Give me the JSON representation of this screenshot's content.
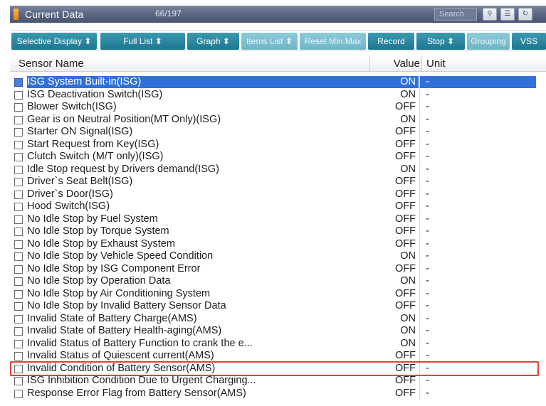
{
  "window": {
    "title": "Current Data",
    "count": "66/197",
    "search_placeholder": "Search"
  },
  "toolbar": {
    "buttons": [
      {
        "label": "Selective Display ⬍",
        "enabled": true
      },
      {
        "label": "Full List   ⬍",
        "enabled": true
      },
      {
        "label": "Graph  ⬍",
        "enabled": true
      },
      {
        "label": "Items List ⬍",
        "enabled": false
      },
      {
        "label": "Reset Min.Max",
        "enabled": false
      },
      {
        "label": "Record",
        "enabled": true
      },
      {
        "label": "Stop  ⬍",
        "enabled": true
      },
      {
        "label": "Grouping",
        "enabled": false
      },
      {
        "label": "VSS",
        "enabled": true
      }
    ]
  },
  "table": {
    "headers": {
      "name": "Sensor Name",
      "value": "Value",
      "unit": "Unit"
    },
    "rows": [
      {
        "name": "ISG System Built-in(ISG)",
        "value": "ON",
        "unit": "-"
      },
      {
        "name": "ISG Deactivation Switch(ISG)",
        "value": "ON",
        "unit": "-"
      },
      {
        "name": "Blower Switch(ISG)",
        "value": "OFF",
        "unit": "-"
      },
      {
        "name": "Gear is on Neutral Position(MT Only)(ISG)",
        "value": "ON",
        "unit": "-"
      },
      {
        "name": "Starter ON Signal(ISG)",
        "value": "OFF",
        "unit": "-"
      },
      {
        "name": "Start Request from Key(ISG)",
        "value": "OFF",
        "unit": "-"
      },
      {
        "name": "Clutch Switch (M/T only)(ISG)",
        "value": "OFF",
        "unit": "-"
      },
      {
        "name": "Idle Stop request by Drivers demand(ISG)",
        "value": "ON",
        "unit": "-"
      },
      {
        "name": "Driver`s Seat Belt(ISG)",
        "value": "OFF",
        "unit": "-"
      },
      {
        "name": "Driver`s Door(ISG)",
        "value": "OFF",
        "unit": "-"
      },
      {
        "name": "Hood Switch(ISG)",
        "value": "OFF",
        "unit": "-"
      },
      {
        "name": "No Idle Stop by Fuel System",
        "value": "OFF",
        "unit": "-"
      },
      {
        "name": "No Idle Stop by Torque System",
        "value": "OFF",
        "unit": "-"
      },
      {
        "name": "No Idle Stop by Exhaust System",
        "value": "OFF",
        "unit": "-"
      },
      {
        "name": "No Idle Stop by Vehicle Speed Condition",
        "value": "ON",
        "unit": "-"
      },
      {
        "name": "No Idle Stop by ISG Component Error",
        "value": "OFF",
        "unit": "-"
      },
      {
        "name": "No Idle Stop by Operation Data",
        "value": "ON",
        "unit": "-"
      },
      {
        "name": "No Idle Stop by Air Conditioning System",
        "value": "OFF",
        "unit": "-"
      },
      {
        "name": "No Idle Stop by Invalid Battery Sensor Data",
        "value": "OFF",
        "unit": "-"
      },
      {
        "name": "Invalid State of Battery Charge(AMS)",
        "value": "ON",
        "unit": "-"
      },
      {
        "name": "Invalid State of Battery Health-aging(AMS)",
        "value": "ON",
        "unit": "-"
      },
      {
        "name": "Invalid Status of Battery Function to crank the e...",
        "value": "ON",
        "unit": "-"
      },
      {
        "name": "Invalid Status of Quiescent current(AMS)",
        "value": "OFF",
        "unit": "-"
      },
      {
        "name": "Invalid Condition of Battery Sensor(AMS)",
        "value": "OFF",
        "unit": "-"
      },
      {
        "name": "ISG Inhibition Condition Due to Urgent Charging...",
        "value": "OFF",
        "unit": "-"
      },
      {
        "name": "Response Error Flag from Battery Sensor(AMS)",
        "value": "OFF",
        "unit": "-"
      }
    ],
    "selected_index": 0,
    "highlighted_index": 23
  },
  "colors": {
    "titlebar": "#5c6884",
    "button": "#2a86a1",
    "selection": "#3070d8",
    "highlight": "#e0403a"
  }
}
